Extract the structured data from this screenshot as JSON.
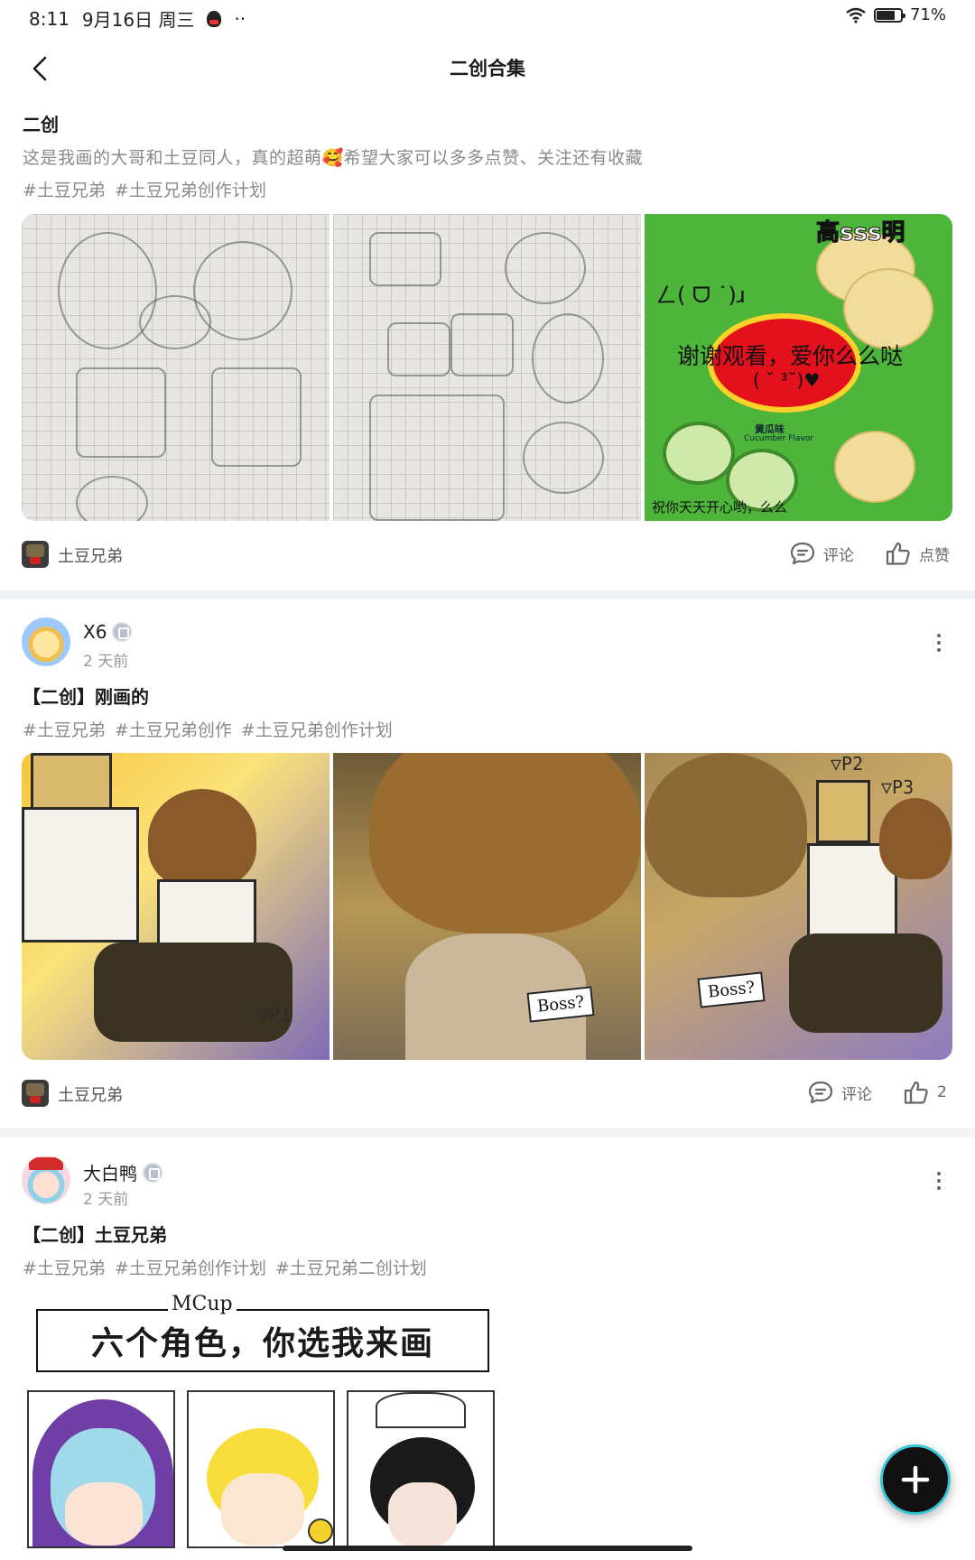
{
  "status_bar": {
    "time": "8:11",
    "date": "9月16日 周三",
    "more": "··",
    "battery": "71%",
    "battery_level": 0.71
  },
  "header": {
    "title": "二创合集"
  },
  "posts": [
    {
      "title": "二创",
      "description": "这是我画的大哥和土豆同人，真的超萌🥰希望大家可以多多点赞、关注还有收藏",
      "tags": [
        "#土豆兄弟",
        "#土豆兄弟创作计划"
      ],
      "image3_texts": {
        "top_text": "高sss明",
        "line1": "ㄥ( ᗜ ˙)ɹ",
        "line2": "谢谢观看，爱你么么哒",
        "line3": "( ˘ ³˘)♥",
        "bottom": "祝你天天开心哟，么么",
        "flavor": "黄瓜味",
        "flavor_en": "Cucumber Flavor"
      },
      "channel": "土豆兄弟",
      "comment_label": "评论",
      "like_label": "点赞"
    },
    {
      "author": "X6",
      "time": "2 天前",
      "title": "【二创】刚画的",
      "tags": [
        "#土豆兄弟",
        "#土豆兄弟创作",
        "#土豆兄弟创作计划"
      ],
      "image_labels": {
        "p1": "▽P1",
        "p2": "▽P2",
        "p3": "▽P3",
        "boss": "Boss?"
      },
      "channel": "土豆兄弟",
      "comment_label": "评论",
      "like_count": "2"
    },
    {
      "author": "大白鸭",
      "time": "2 天前",
      "title": "【二创】土豆兄弟",
      "tags": [
        "#土豆兄弟",
        "#土豆兄弟创作计划",
        "#土豆兄弟二创计划"
      ],
      "image_texts": {
        "mcup": "MCup",
        "heading": "六个角色，你选我来画"
      }
    }
  ],
  "colors": {
    "accent_ring": "#3ac6d8",
    "separator": "#f2f3f5",
    "meta_text": "#8a8a8a"
  },
  "icons": {
    "back": "chevron-left-icon",
    "comment": "comment-bubble-icon",
    "like": "thumbs-up-icon",
    "more": "more-vertical-icon",
    "fab": "plus-icon"
  }
}
